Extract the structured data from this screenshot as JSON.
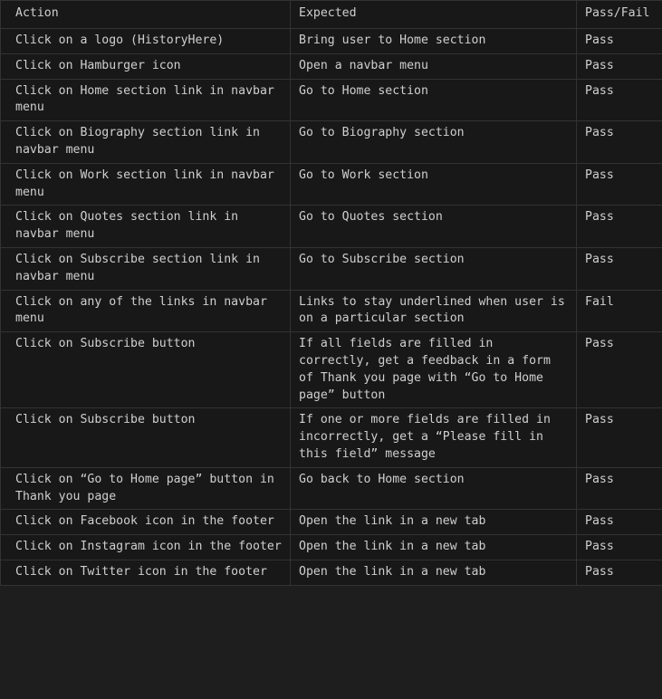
{
  "columns": [
    "Action",
    "Expected",
    "Pass/Fail"
  ],
  "rows": [
    [
      "Click on a logo (HistoryHere)",
      "Bring user to Home section",
      "Pass"
    ],
    [
      "Click on Hamburger icon",
      "Open a navbar menu",
      "Pass"
    ],
    [
      "Click on Home section link in navbar menu",
      "Go to Home section",
      "Pass"
    ],
    [
      "Click on Biography section link in navbar menu",
      "Go to Biography section",
      "Pass"
    ],
    [
      "Click on Work section link in navbar menu",
      "Go to Work section",
      "Pass"
    ],
    [
      "Click on Quotes section link in navbar menu",
      "Go to Quotes section",
      "Pass"
    ],
    [
      "Click on Subscribe section link in navbar menu",
      "Go to Subscribe section",
      "Pass"
    ],
    [
      "Click on any of the links in navbar menu",
      "Links to stay underlined when user is on a particular section",
      "Fail"
    ],
    [
      "Click on Subscribe button",
      "If all fields are filled in correctly, get a feedback in a form of Thank you page with “Go to Home page” button",
      "Pass"
    ],
    [
      "Click on Subscribe button",
      "If one or more fields are filled in incorrectly, get a “Please fill in this field” message",
      "Pass"
    ],
    [
      "Click on “Go to Home page” button in Thank you page",
      "Go back to Home section",
      "Pass"
    ],
    [
      "Click on Facebook icon in the footer",
      "Open the link in a new tab",
      "Pass"
    ],
    [
      "Click on Instagram icon in the footer",
      "Open the link in a new tab",
      "Pass"
    ],
    [
      "Click on Twitter icon in the footer",
      "Open the link in a new tab",
      "Pass"
    ]
  ]
}
